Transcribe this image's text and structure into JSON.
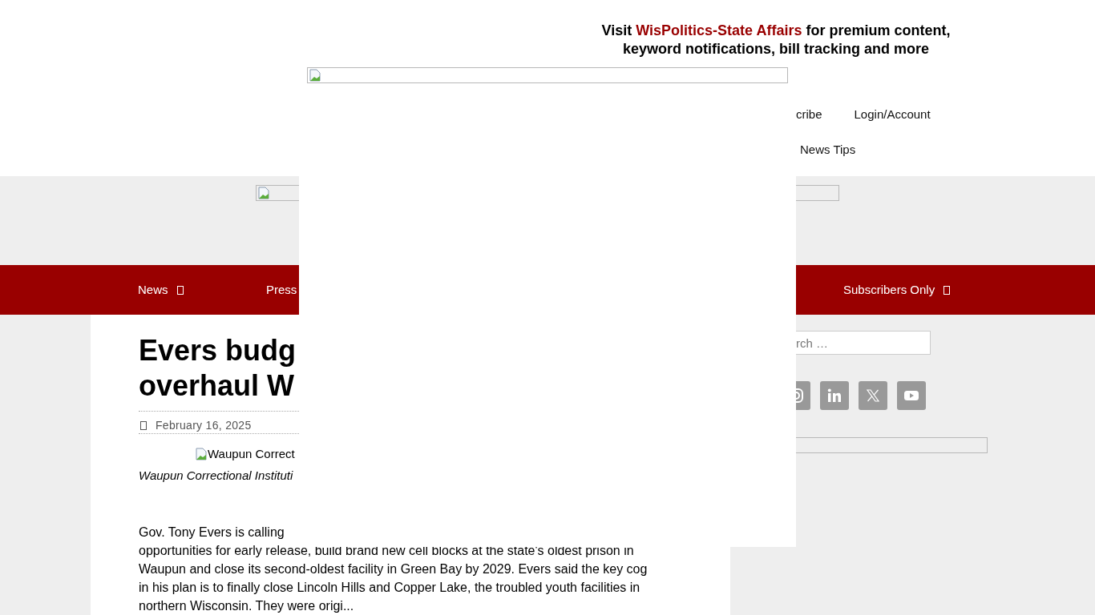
{
  "promo": {
    "before": "Visit",
    "link": "WisPolitics-State Affairs",
    "after": "for premium content, keyword notifications, bill tracking and more"
  },
  "header_links": [
    [
      "cribe",
      "Login/Account"
    ],
    [
      "News Tips"
    ]
  ],
  "main_nav": [
    {
      "label": "News",
      "has_submenu": true
    },
    {
      "label": "Press",
      "has_submenu": false
    },
    {
      "label": "Subscribers Only",
      "has_submenu": true
    }
  ],
  "article": {
    "title_lines": [
      "Evers budg",
      "overhaul W"
    ],
    "date": "February 16, 2025",
    "image_alt": "Waupun Correct",
    "caption": "Waupun Correctional Instituti",
    "paragraph_lines": [
      "Gov. Tony Evers is calling",
      "opportunities for early release, build brand new cell blocks at the state's oldest prison in",
      "Waupun and close its second-oldest facility in Green Bay by 2029. Evers said the key cog",
      "in his plan is to finally close Lincoln Hills and Copper Lake, the troubled youth facilities in",
      "northern Wisconsin. They were origi..."
    ]
  },
  "sidebar": {
    "search": {
      "placeholder": "rch …"
    }
  }
}
